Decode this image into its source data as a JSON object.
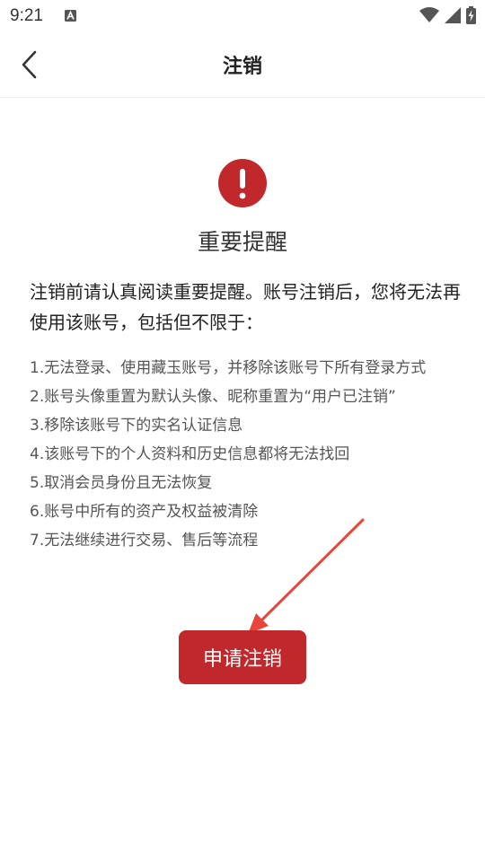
{
  "status_bar": {
    "time": "9:21",
    "notification_icon": "a-box-icon",
    "wifi_icon": "wifi-icon",
    "signal_icon": "signal-icon",
    "battery_icon": "battery-charging-icon"
  },
  "header": {
    "back_icon": "chevron-left-icon",
    "title": "注销"
  },
  "main": {
    "warning_icon": "exclamation-circle-icon",
    "heading": "重要提醒",
    "intro": "注销前请认真阅读重要提醒。账号注销后，您将无法再使用该账号，包括但不限于：",
    "rules": [
      "1.无法登录、使用藏玉账号，并移除该账号下所有登录方式",
      "2.账号头像重置为默认头像、昵称重置为“用户已注销”",
      "3.移除该账号下的实名认证信息",
      "4.该账号下的个人资料和历史信息都将无法找回",
      "5.取消会员身份且无法恢复",
      "6.账号中所有的资产及权益被清除",
      "7.无法继续进行交易、售后等流程"
    ],
    "apply_button_label": "申请注销"
  },
  "colors": {
    "accent": "#c0282c",
    "arrow": "#e8463c"
  }
}
